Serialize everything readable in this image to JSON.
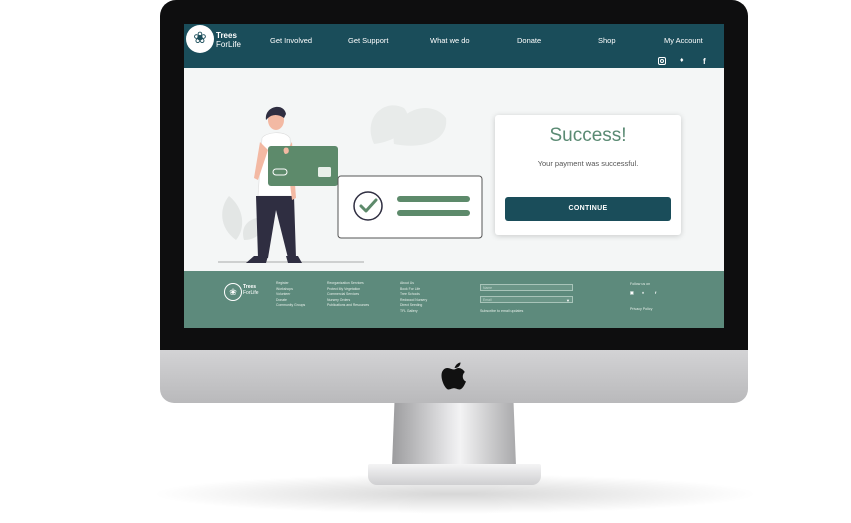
{
  "header": {
    "logo_line1": "Trees",
    "logo_line2": "ForLife",
    "nav": [
      "Get Involved",
      "Get Support",
      "What we do",
      "Donate",
      "Shop",
      "My Account"
    ],
    "social_icons": [
      "instagram-icon",
      "twitter-icon",
      "facebook-icon"
    ]
  },
  "success": {
    "title": "Success!",
    "message": "Your payment was successful.",
    "button": "CONTINUE"
  },
  "footer": {
    "logo_line1": "Trees",
    "logo_line2": "ForLife",
    "col1": [
      "Register",
      "Workshops",
      "Volunteer",
      "Donate",
      "Community Groups"
    ],
    "col2": [
      "Reorganization Services",
      "Protect My Vegetation",
      "Commercial Services",
      "Nursery Orders",
      "Publications and Resources"
    ],
    "col3": [
      "About Us",
      "Book For Life",
      "Tree Schools",
      "Redwood Nursery",
      "Direct Seeding",
      "TFL Gallery"
    ],
    "name_placeholder": "Name",
    "email_placeholder": "Email",
    "subscribe_text": "Subscribe to email updates",
    "follow_text": "Follow us on",
    "privacy": "Privacy Policy"
  },
  "colors": {
    "header_bg": "#1a4d5a",
    "accent_green": "#5a8a73",
    "footer_bg": "#5d8a7c"
  }
}
